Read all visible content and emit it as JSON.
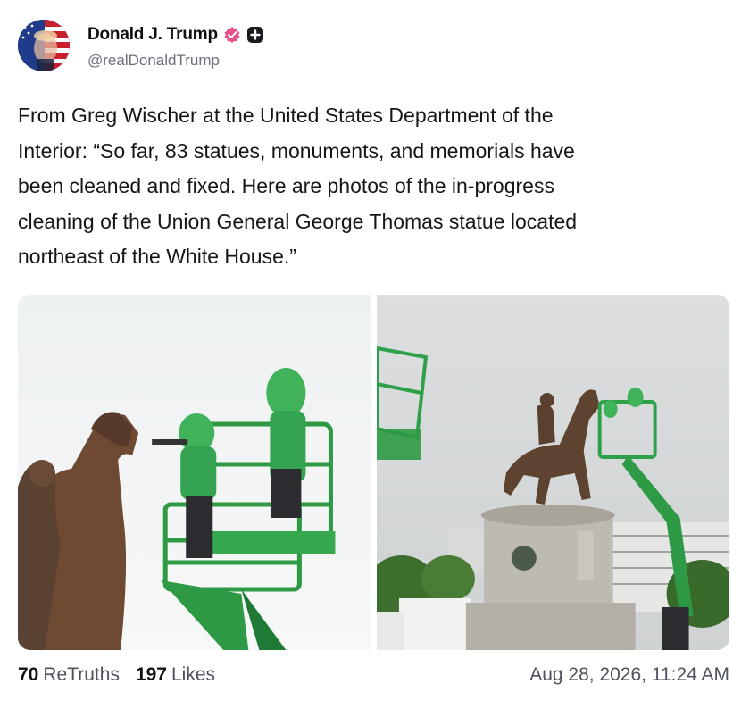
{
  "author": {
    "display_name": "Donald J. Trump",
    "handle": "@realDonaldTrump",
    "avatar_icon": "flag-portrait-avatar",
    "verified_icon": "verified-badge-icon",
    "badge_icon": "plus-badge-icon",
    "verified_color": "#e8508a"
  },
  "post": {
    "text": "From Greg Wischer at the United States Department of the\nInterior: “So far, 83 statues, monuments, and memorials have\nbeen cleaned and fixed. Here are photos of the in-progress\ncleaning of the Union General George Thomas statue located\nnortheast of the White House.”"
  },
  "media": {
    "photo_1": "statue-cleaning-closeup-photo",
    "photo_2": "statue-monument-wide-photo"
  },
  "stats": {
    "retruths_count": "70",
    "retruths_label": "ReTruths",
    "likes_count": "197",
    "likes_label": "Likes"
  },
  "timestamp": "Aug 28, 2026, 11:24 AM",
  "colors": {
    "text": "#14161a",
    "muted": "#4e525c",
    "lift_green": "#3aa64a"
  }
}
